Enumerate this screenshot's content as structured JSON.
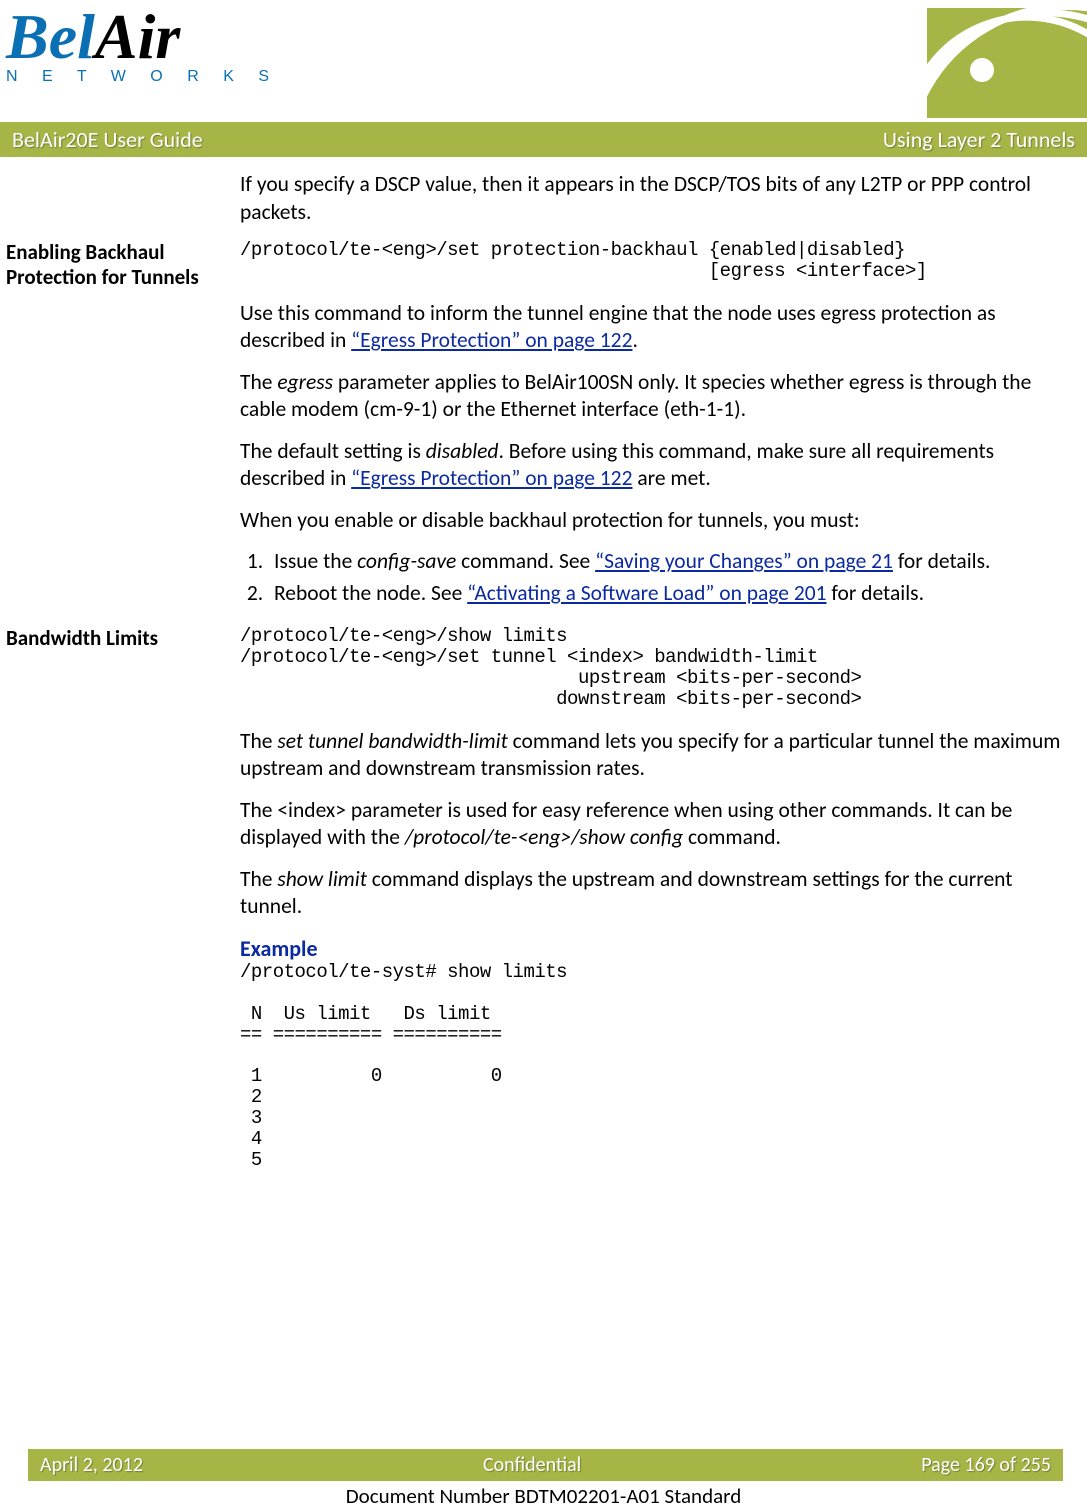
{
  "header": {
    "logo_part1": "Bel",
    "logo_part2": "Air",
    "logo_sub": "N E T W O R K S"
  },
  "titlebar": {
    "left": "BelAir20E User Guide",
    "right": "Using Layer 2 Tunnels"
  },
  "intro_para": "If you specify a DSCP value, then it appears in the DSCP/TOS bits of any L2TP or PPP control packets.",
  "section1": {
    "heading": "Enabling Backhaul Protection for Tunnels",
    "code": "/protocol/te-<eng>/set protection-backhaul {enabled|disabled}\n                                           [egress <interface>]",
    "p1_a": "Use this command to inform the tunnel engine that the node uses egress protection as described in ",
    "p1_link": "“Egress Protection” on page 122",
    "p1_b": ".",
    "p2_a": "The ",
    "p2_i": "egress",
    "p2_b": " parameter applies to BelAir100SN only. It species whether egress is through the cable modem (cm-9-1) or the Ethernet interface (eth-1-1).",
    "p3_a": "The default setting is ",
    "p3_i": "disabled",
    "p3_b": ". Before using this command, make sure all requirements described in ",
    "p3_link": "“Egress Protection” on page 122",
    "p3_c": " are met.",
    "p4": "When you enable or disable backhaul protection for tunnels, you must:",
    "li1_a": "Issue the ",
    "li1_i": "config-save",
    "li1_b": " command. See ",
    "li1_link": "“Saving your Changes” on page 21",
    "li1_c": " for details.",
    "li2_a": "Reboot the node. See ",
    "li2_link": "“Activating a Software Load” on page 201",
    "li2_b": " for details."
  },
  "section2": {
    "heading": "Bandwidth Limits",
    "code": "/protocol/te-<eng>/show limits\n/protocol/te-<eng>/set tunnel <index> bandwidth-limit\n                               upstream <bits-per-second>\n                             downstream <bits-per-second>",
    "p1_a": "The ",
    "p1_i": "set tunnel bandwidth-limit",
    "p1_b": " command lets you specify for a particular tunnel the maximum upstream and downstream transmission rates.",
    "p2_a": "The <index> parameter is used for easy reference when using other commands. It can be displayed with the ",
    "p2_i": "/protocol/te-<eng>/show config",
    "p2_b": " command.",
    "p3_a": "The ",
    "p3_i": "show limit",
    "p3_b": " command displays the upstream and downstream settings for the current tunnel.",
    "example_label": "Example",
    "example_code": "/protocol/te-syst# show limits\n\n N  Us limit   Ds limit\n== ========== ==========\n\n 1          0          0\n 2\n 3\n 4\n 5"
  },
  "footer": {
    "left": "April 2, 2012",
    "center": "Confidential",
    "right": "Page 169 of 255",
    "docnum": "Document Number BDTM02201-A01 Standard"
  }
}
